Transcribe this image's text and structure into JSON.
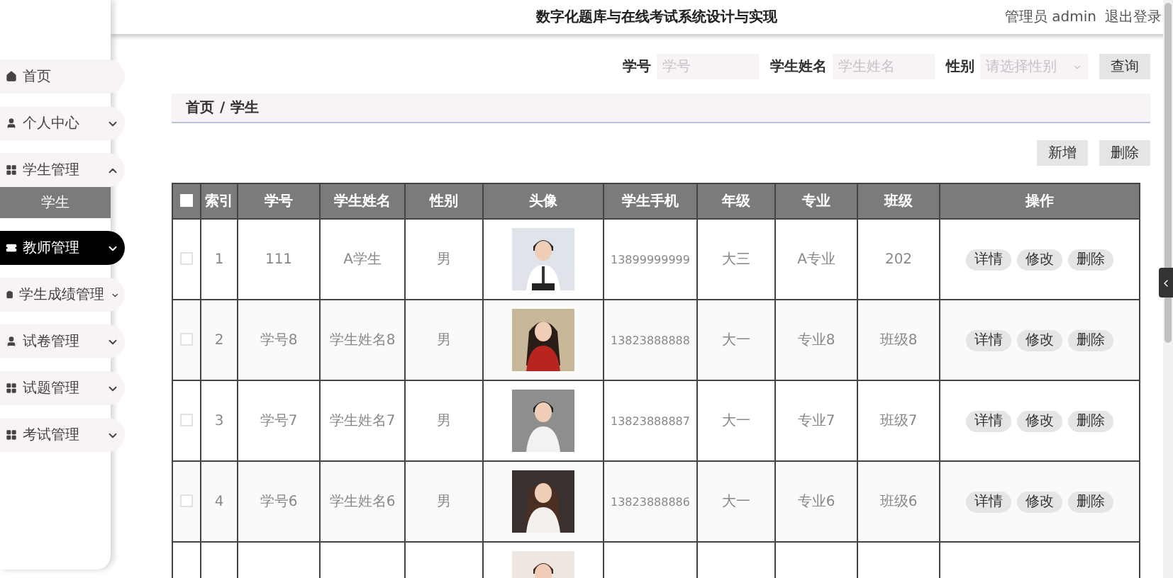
{
  "header": {
    "title": "数字化题库与在线考试系统设计与实现",
    "role": "管理员 admin",
    "logout": "退出登录"
  },
  "sidebar": {
    "items": [
      {
        "label": "首页",
        "kind": "link",
        "selected": false
      },
      {
        "label": "个人中心",
        "kind": "menu",
        "expanded": false,
        "selected": false
      },
      {
        "label": "学生管理",
        "kind": "menu",
        "expanded": true,
        "selected": false,
        "children": [
          {
            "label": "学生",
            "selected": true
          }
        ]
      },
      {
        "label": "教师管理",
        "kind": "menu",
        "expanded": false,
        "selected": true
      },
      {
        "label": "学生成绩管理",
        "kind": "menu",
        "expanded": false,
        "selected": false
      },
      {
        "label": "试卷管理",
        "kind": "menu",
        "expanded": false,
        "selected": false
      },
      {
        "label": "试题管理",
        "kind": "menu",
        "expanded": false,
        "selected": false
      },
      {
        "label": "考试管理",
        "kind": "menu",
        "expanded": false,
        "selected": false
      }
    ]
  },
  "search": {
    "fields": [
      {
        "label": "学号",
        "placeholder": "学号",
        "kind": "input"
      },
      {
        "label": "学生姓名",
        "placeholder": "学生姓名",
        "kind": "input"
      },
      {
        "label": "性别",
        "placeholder": "请选择性别",
        "kind": "select"
      }
    ],
    "button": "查询"
  },
  "breadcrumb": {
    "items": [
      "首页",
      "学生"
    ],
    "separator": "/"
  },
  "actions": [
    "新增",
    "删除"
  ],
  "table": {
    "header_checkbox": {
      "checked": false
    },
    "columns": [
      "索引",
      "学号",
      "学生姓名",
      "性别",
      "头像",
      "学生手机",
      "年级",
      "专业",
      "班级",
      "操作"
    ],
    "rows": [
      {
        "checked": false,
        "cells": [
          "1",
          "111",
          "A学生",
          "男"
        ],
        "avatar": {
          "kind": "picture"
        },
        "rest": [
          "13899999999",
          "大三",
          "A专业",
          "202"
        ],
        "buttons": [
          "详情",
          "修改",
          "删除"
        ]
      },
      {
        "checked": false,
        "cells": [
          "2",
          "学号8",
          "学生姓名8",
          "男"
        ],
        "avatar": {
          "kind": "picture"
        },
        "rest": [
          "13823888888",
          "大一",
          "专业8",
          "班级8"
        ],
        "buttons": [
          "详情",
          "修改",
          "删除"
        ]
      },
      {
        "checked": false,
        "cells": [
          "3",
          "学号7",
          "学生姓名7",
          "男"
        ],
        "avatar": {
          "kind": "picture"
        },
        "rest": [
          "13823888887",
          "大一",
          "专业7",
          "班级7"
        ],
        "buttons": [
          "详情",
          "修改",
          "删除"
        ]
      },
      {
        "checked": false,
        "cells": [
          "4",
          "学号6",
          "学生姓名6",
          "男"
        ],
        "avatar": {
          "kind": "picture"
        },
        "rest": [
          "13823888886",
          "大一",
          "专业6",
          "班级6"
        ],
        "buttons": [
          "详情",
          "修改",
          "删除"
        ]
      },
      {
        "avatar": {
          "kind": "picture"
        }
      }
    ]
  }
}
